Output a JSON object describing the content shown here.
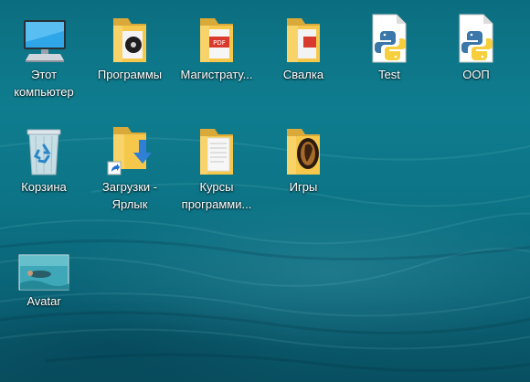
{
  "desktop": {
    "icons": [
      {
        "label": "Этот компьютер",
        "icon": "this-pc-icon"
      },
      {
        "label": "Программы",
        "icon": "folder-icon"
      },
      {
        "label": "Магистрату...",
        "icon": "folder-icon"
      },
      {
        "label": "Свалка",
        "icon": "folder-icon"
      },
      {
        "label": "Test",
        "icon": "python-file-icon"
      },
      {
        "label": "ООП",
        "icon": "python-file-icon"
      },
      {
        "label": "Корзина",
        "icon": "recycle-bin-icon"
      },
      {
        "label": "Загрузки - Ярлык",
        "icon": "downloads-shortcut-icon"
      },
      {
        "label": "Курсы программи...",
        "icon": "folder-icon"
      },
      {
        "label": "Игры",
        "icon": "folder-icon"
      },
      {
        "label": "Avatar",
        "icon": "image-file-icon"
      }
    ]
  },
  "colors": {
    "wallpaper": "#0c7385",
    "folder": "#f5c84c",
    "python_blue": "#3b77a8",
    "python_yellow": "#f7cf3d"
  }
}
